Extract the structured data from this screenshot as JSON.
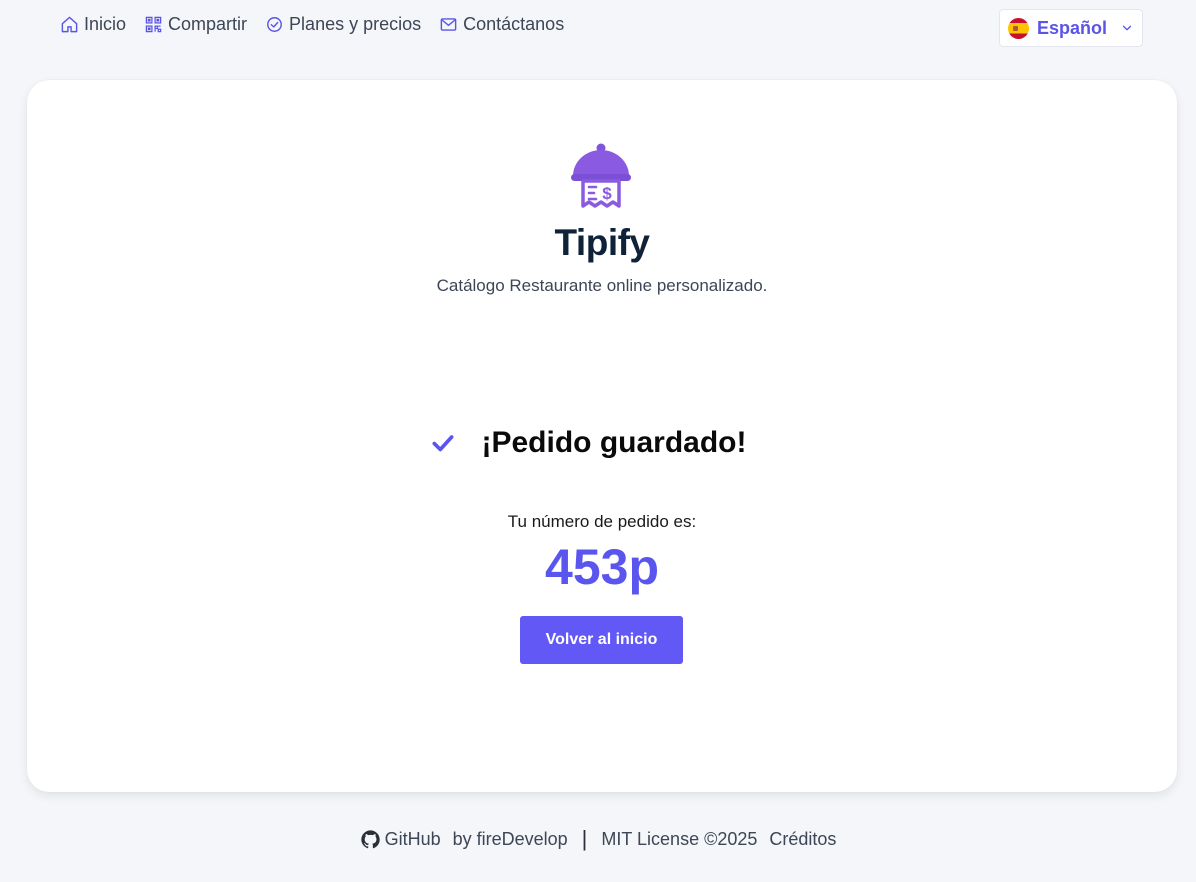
{
  "nav": {
    "items": [
      {
        "label": "Inicio",
        "icon": "home-icon"
      },
      {
        "label": "Compartir",
        "icon": "qr-code-icon"
      },
      {
        "label": "Planes y precios",
        "icon": "check-circle-icon"
      },
      {
        "label": "Contáctanos",
        "icon": "mail-icon"
      }
    ],
    "language": {
      "label": "Español",
      "icon": "spain-flag-icon"
    }
  },
  "brand": {
    "name": "Tipify",
    "tagline": "Catálogo Restaurante online personalizado.",
    "logo_icon": "cloche-receipt-icon"
  },
  "order": {
    "status_title": "¡Pedido guardado!",
    "number_label": "Tu número de pedido es:",
    "number": "453p",
    "back_button": "Volver al inicio"
  },
  "footer": {
    "github": "GitHub",
    "author": "by fireDevelop",
    "separator": "|",
    "license": "MIT License ©2025",
    "credits": "Créditos"
  },
  "colors": {
    "accent": "#5b55f0",
    "brand_purple": "#7b4fd6",
    "page_bg": "#f4f6f9"
  }
}
